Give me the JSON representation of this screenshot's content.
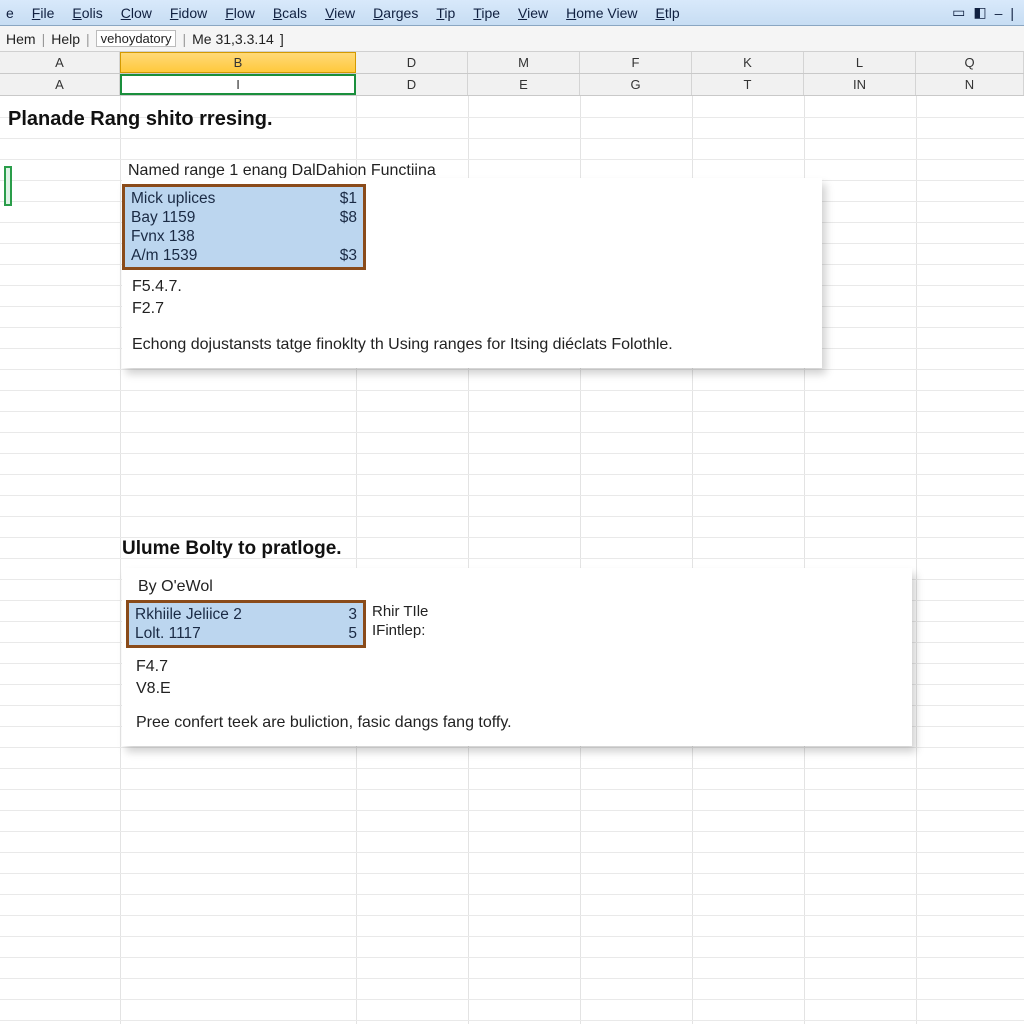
{
  "menubar": {
    "items": [
      "e",
      "File",
      "Eolis",
      "Clow",
      "Fidow",
      "Flow",
      "Bcals",
      "View",
      "Darges",
      "Tip",
      "Tipe",
      "View",
      "Home View",
      "Etlp"
    ]
  },
  "infobar": {
    "a": "Hem",
    "b": "Help",
    "c": "vehoydatory",
    "d": "Me 31,3.3.14"
  },
  "hdr1": {
    "cols": [
      "A",
      "B",
      "D",
      "M",
      "F",
      "K",
      "L",
      "Q"
    ],
    "widths": [
      120,
      236,
      112,
      112,
      112,
      112,
      112,
      108
    ],
    "selected_index": 1
  },
  "hdr2": {
    "cols": [
      "A",
      "I",
      "D",
      "E",
      "G",
      "T",
      "IN",
      "N"
    ],
    "widths": [
      120,
      236,
      112,
      112,
      112,
      112,
      112,
      108
    ],
    "selected_index": 1
  },
  "section1": {
    "title": "Planade Rang shito rresing.",
    "subtitle": "Named range 1 enang DalDahion Functiina",
    "range": [
      {
        "label": "Mick uplices",
        "val": "$1"
      },
      {
        "label": "Bay 1159",
        "val": "$8"
      },
      {
        "label": "Fvnx 138",
        "val": ""
      },
      {
        "label": "A/m 1539",
        "val": "$3"
      }
    ],
    "refs": [
      "F5.4.7.",
      "F2.7"
    ],
    "desc": "Echong dojustansts tatge finoklty th Using ranges for Itsing diéclats Folothle."
  },
  "section2": {
    "title": "Ulume Bolty to pratloge.",
    "byline": "By O'eWol",
    "range": [
      {
        "label": "Rkhiile Jeliice 2",
        "val": "3"
      },
      {
        "label": "Lolt.   1117",
        "val": "5"
      }
    ],
    "sidelabels": [
      "Rhir TIle",
      "IFintlep:"
    ],
    "refs": [
      "F4.7",
      "V8.E"
    ],
    "desc": "Pree confert teek are buliction, fasic dangs fang toffy."
  },
  "grid": {
    "vlines": [
      120,
      356,
      468,
      580,
      692,
      804,
      916
    ],
    "hlines_step": 21,
    "hlines_count": 44
  }
}
